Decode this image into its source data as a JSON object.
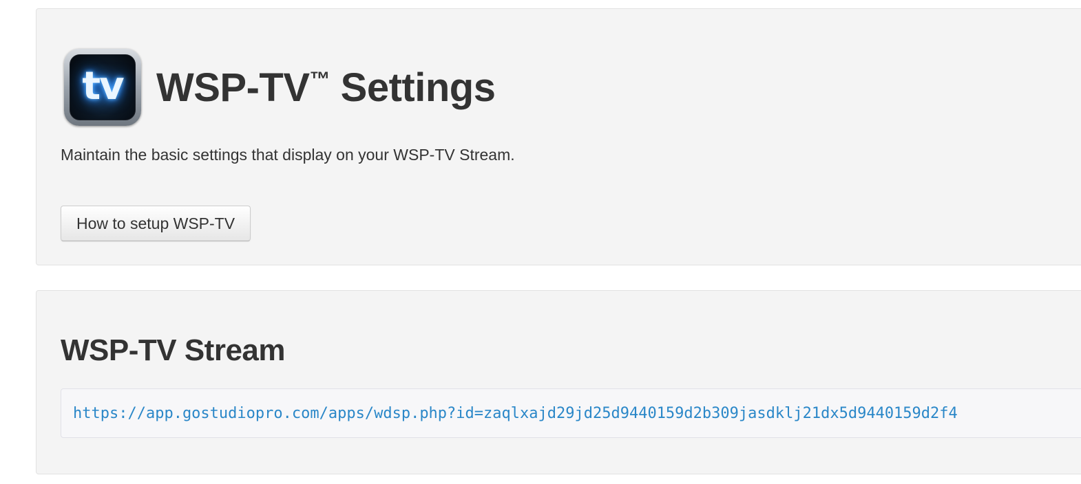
{
  "settings_panel": {
    "icon": {
      "name": "tv-app-icon",
      "glyph": "tv"
    },
    "title": "WSP-TV",
    "title_mark": "™",
    "title_suffix": " Settings",
    "description": "Maintain the basic settings that display on your WSP-TV Stream.",
    "setup_button_label": "How to setup WSP-TV"
  },
  "stream_panel": {
    "title": "WSP-TV Stream",
    "url": "https://app.gostudiopro.com/apps/wdsp.php?id=zaqlxajd29jd25d9440159d2b309jasdklj21dx5d9440159d2f4"
  },
  "colors": {
    "panel_background": "#f4f4f4",
    "text": "#333333",
    "link": "#2a87c8"
  }
}
